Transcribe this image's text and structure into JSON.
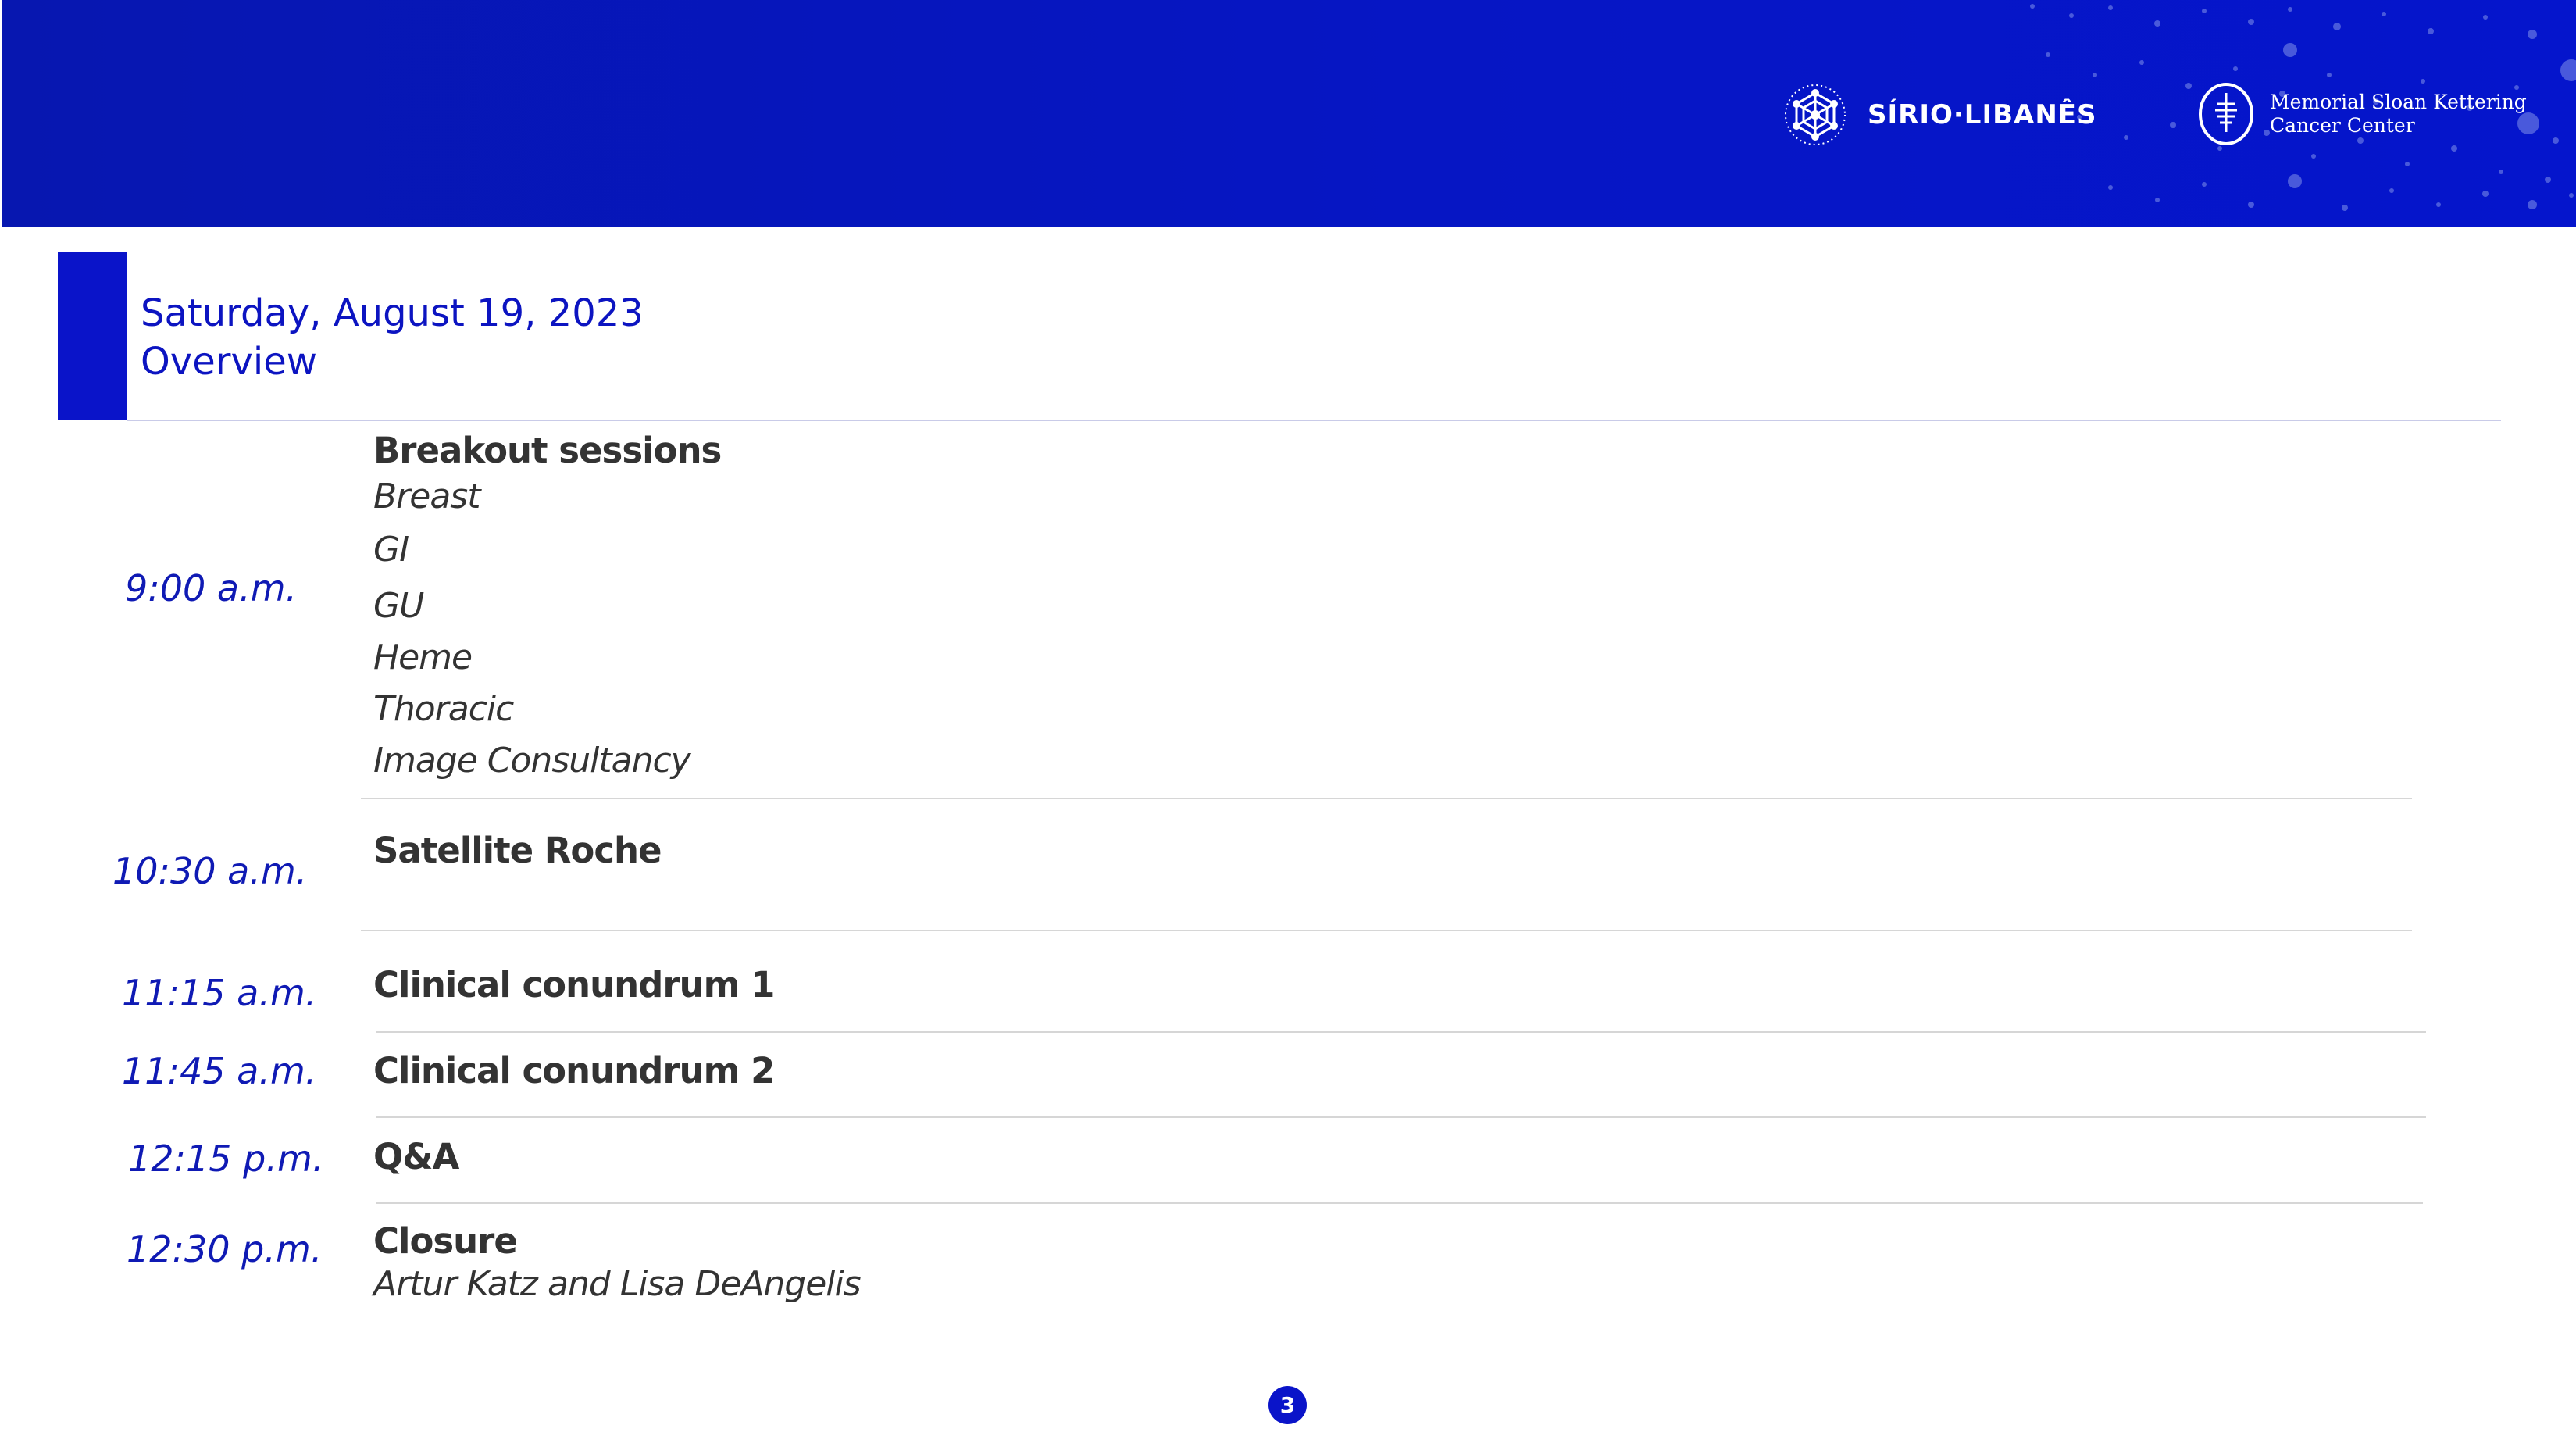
{
  "header": {
    "logo_sirio": "SÍRIO·LIBANÊS",
    "logo_msk_line1": "Memorial Sloan Kettering",
    "logo_msk_line2": "Cancer Center",
    "banner_color": "#0616c4"
  },
  "title": {
    "line1": "Saturday, August 19, 2023",
    "line2": "Overview",
    "color": "#0c14c1"
  },
  "schedule": [
    {
      "time": "9:00 a.m.",
      "title": "Breakout sessions",
      "items": [
        "Breast",
        "GI",
        "GU",
        "Heme",
        "Thoracic",
        "Image Consultancy"
      ]
    },
    {
      "time": "10:30 a.m.",
      "title": "Satellite Roche"
    },
    {
      "time": "11:15 a.m.",
      "title": "Clinical conundrum 1"
    },
    {
      "time": "11:45 a.m.",
      "title": "Clinical conundrum 2"
    },
    {
      "time": "12:15 p.m.",
      "title": "Q&A"
    },
    {
      "time": "12:30 p.m.",
      "title": "Closure",
      "subtitle": "Artur Katz and Lisa DeAngelis"
    }
  ],
  "page_number": "3"
}
